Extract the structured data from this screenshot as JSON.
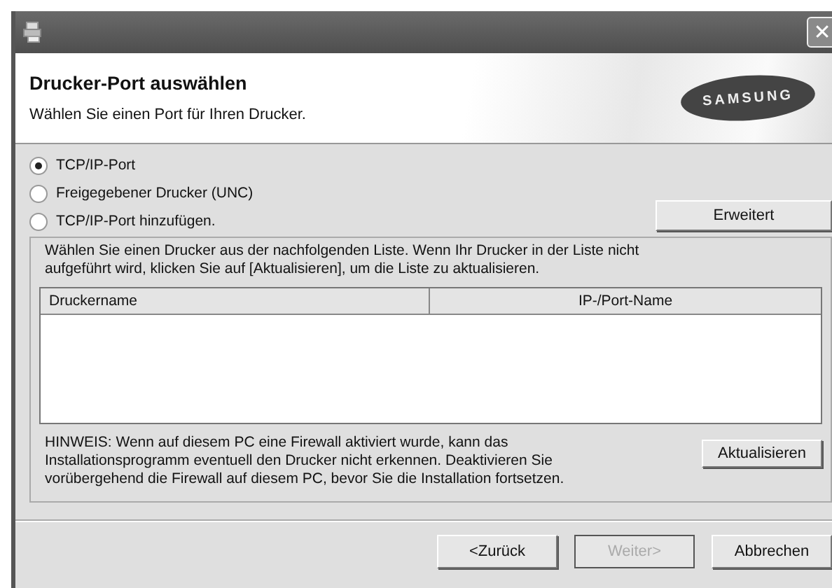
{
  "window": {
    "close": "✕"
  },
  "header": {
    "title": "Drucker-Port auswählen",
    "subtitle": "Wählen Sie einen Port für Ihren Drucker.",
    "logo": "SAMSUNG"
  },
  "port_options": [
    {
      "label": "TCP/IP-Port",
      "selected": true
    },
    {
      "label": "Freigegebener Drucker (UNC)",
      "selected": false
    },
    {
      "label": "TCP/IP-Port hinzufügen.",
      "selected": false
    }
  ],
  "advanced_button": "Erweitert",
  "printer_group": {
    "instructions": "Wählen Sie einen Drucker aus der nachfolgenden Liste. Wenn Ihr Drucker in der Liste nicht aufgeführt wird, klicken Sie auf [Aktualisieren], um die Liste zu aktualisieren.",
    "columns": [
      "Druckername",
      "IP-/Port-Name"
    ],
    "note": "HINWEIS: Wenn auf diesem PC eine Firewall aktiviert wurde, kann das Installationsprogramm eventuell den Drucker nicht erkennen. Deaktivieren Sie vorübergehend die Firewall auf diesem PC, bevor Sie die Installation fortsetzen.",
    "refresh_button": "Aktualisieren"
  },
  "buttons": [
    {
      "label": "<Zurück",
      "disabled": false
    },
    {
      "label": "Weiter>",
      "disabled": true
    },
    {
      "label": "Abbrechen",
      "disabled": false
    }
  ]
}
